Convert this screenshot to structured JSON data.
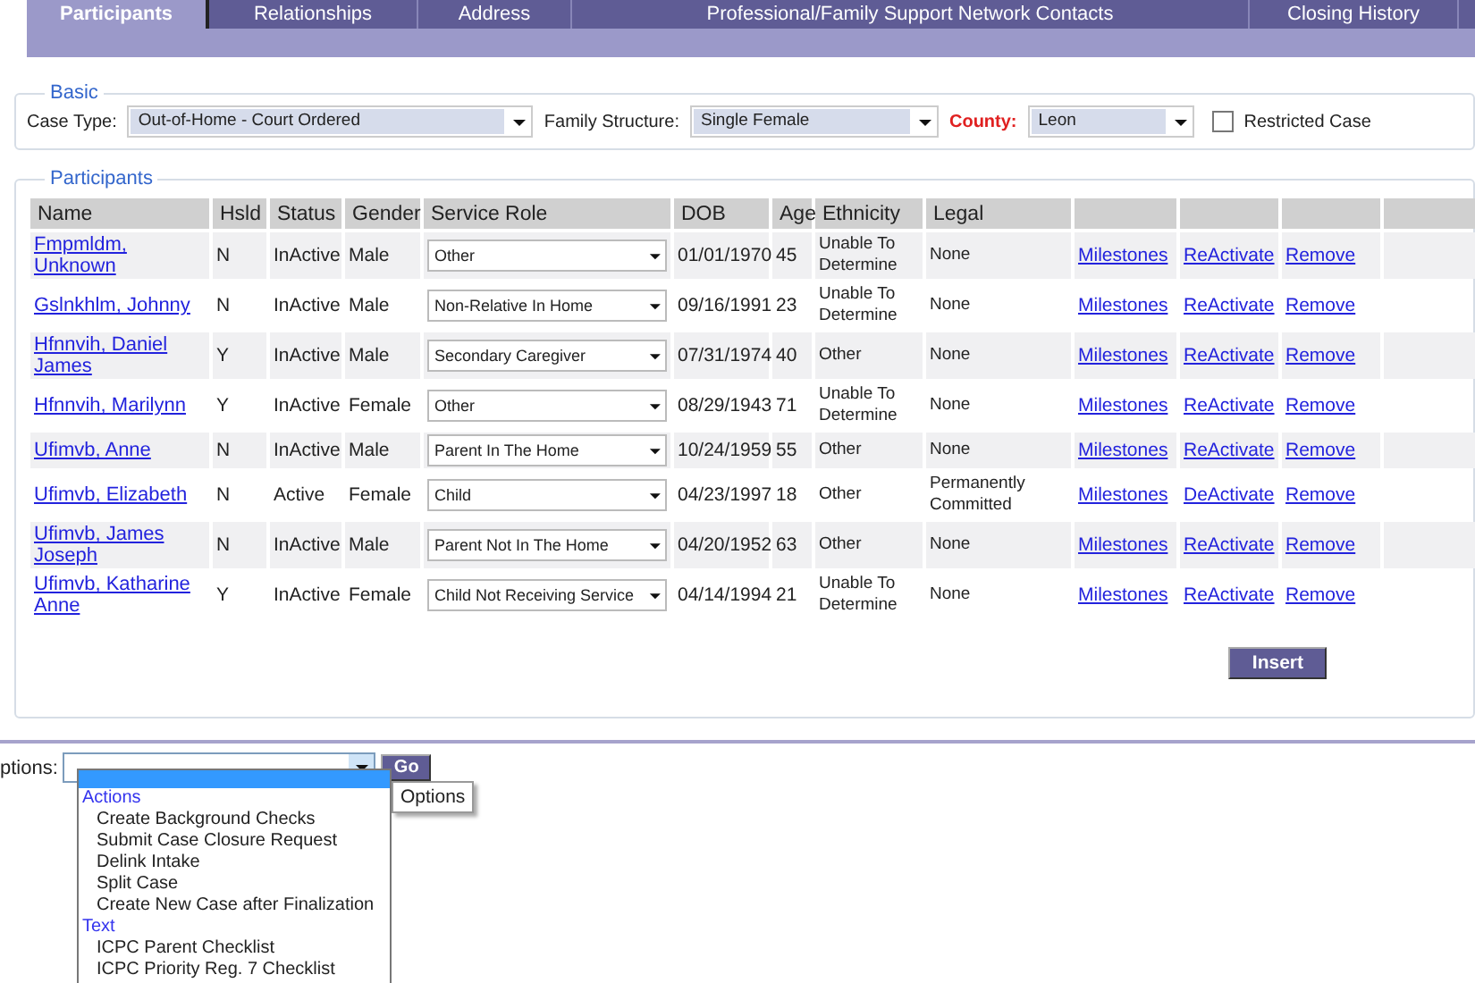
{
  "tabs": [
    {
      "label": "Participants",
      "selected": true
    },
    {
      "label": "Relationships",
      "selected": false
    },
    {
      "label": "Address",
      "selected": false
    },
    {
      "label": "Professional/Family Support Network Contacts",
      "selected": false
    },
    {
      "label": "Closing History",
      "selected": false
    }
  ],
  "basic": {
    "legend": "Basic",
    "case_type": {
      "label": "Case Type:",
      "value": "Out-of-Home - Court Ordered"
    },
    "family_structure": {
      "label": "Family Structure:",
      "value": "Single Female"
    },
    "county": {
      "label": "County:",
      "value": "Leon",
      "required": true
    },
    "restricted_case": {
      "label": "Restricted Case",
      "checked": false
    }
  },
  "participants": {
    "legend": "Participants",
    "columns": [
      "Name",
      "Hsld",
      "Status",
      "Gender",
      "Service Role",
      "DOB",
      "Age",
      "Ethnicity",
      "Legal"
    ],
    "rows": [
      {
        "name": "Fmpmldm, Unknown",
        "hsld": "N",
        "status": "InActive",
        "gender": "Male",
        "service_role": "Other",
        "dob": "01/01/1970",
        "age": "45",
        "ethnicity": "Unable To Determine",
        "legal": "None",
        "actions": [
          "Milestones",
          "ReActivate",
          "Remove"
        ]
      },
      {
        "name": "Gslnkhlm, Johnny",
        "hsld": "N",
        "status": "InActive",
        "gender": "Male",
        "service_role": "Non-Relative In Home",
        "dob": "09/16/1991",
        "age": "23",
        "ethnicity": "Unable To Determine",
        "legal": "None",
        "actions": [
          "Milestones",
          "ReActivate",
          "Remove"
        ]
      },
      {
        "name": "Hfnnvih, Daniel James",
        "hsld": "Y",
        "status": "InActive",
        "gender": "Male",
        "service_role": "Secondary Caregiver",
        "dob": "07/31/1974",
        "age": "40",
        "ethnicity": "Other",
        "legal": "None",
        "actions": [
          "Milestones",
          "ReActivate",
          "Remove"
        ]
      },
      {
        "name": "Hfnnvih, Marilynn",
        "hsld": "Y",
        "status": "InActive",
        "gender": "Female",
        "service_role": "Other",
        "dob": "08/29/1943",
        "age": "71",
        "ethnicity": "Unable To Determine",
        "legal": "None",
        "actions": [
          "Milestones",
          "ReActivate",
          "Remove"
        ]
      },
      {
        "name": "Ufimvb, Anne",
        "hsld": "N",
        "status": "InActive",
        "gender": "Male",
        "service_role": "Parent In The Home",
        "dob": "10/24/1959",
        "age": "55",
        "ethnicity": "Other",
        "legal": "None",
        "actions": [
          "Milestones",
          "ReActivate",
          "Remove"
        ]
      },
      {
        "name": "Ufimvb, Elizabeth",
        "hsld": "N",
        "status": "Active",
        "gender": "Female",
        "service_role": "Child",
        "dob": "04/23/1997",
        "age": "18",
        "ethnicity": "Other",
        "legal": "Permanently Committed",
        "actions": [
          "Milestones",
          "DeActivate",
          "Remove"
        ]
      },
      {
        "name": "Ufimvb, James Joseph",
        "hsld": "N",
        "status": "InActive",
        "gender": "Male",
        "service_role": "Parent Not In The Home",
        "dob": "04/20/1952",
        "age": "63",
        "ethnicity": "Other",
        "legal": "None",
        "actions": [
          "Milestones",
          "ReActivate",
          "Remove"
        ]
      },
      {
        "name": "Ufimvb, Katharine Anne",
        "hsld": "Y",
        "status": "InActive",
        "gender": "Female",
        "service_role": "Child Not Receiving Service",
        "dob": "04/14/1994",
        "age": "21",
        "ethnicity": "Unable To Determine",
        "legal": "None",
        "actions": [
          "Milestones",
          "ReActivate",
          "Remove"
        ]
      }
    ],
    "insert_button": "Insert"
  },
  "options": {
    "label": "ptions:",
    "go_button": "Go",
    "tooltip": "Options",
    "list": [
      {
        "kind": "blank",
        "selected": true
      },
      {
        "kind": "group",
        "label": "Actions"
      },
      {
        "kind": "option",
        "label": "Create Background Checks",
        "selected": false
      },
      {
        "kind": "option",
        "label": "Submit Case Closure Request",
        "selected": false
      },
      {
        "kind": "option",
        "label": "Delink Intake",
        "selected": false
      },
      {
        "kind": "option",
        "label": "Split Case",
        "selected": false
      },
      {
        "kind": "option",
        "label": "Create New Case after Finalization",
        "selected": false
      },
      {
        "kind": "group",
        "label": "Text"
      },
      {
        "kind": "option",
        "label": "ICPC Parent Checklist",
        "selected": false
      },
      {
        "kind": "option",
        "label": "ICPC Priority Reg. 7 Checklist",
        "selected": false
      }
    ]
  }
}
